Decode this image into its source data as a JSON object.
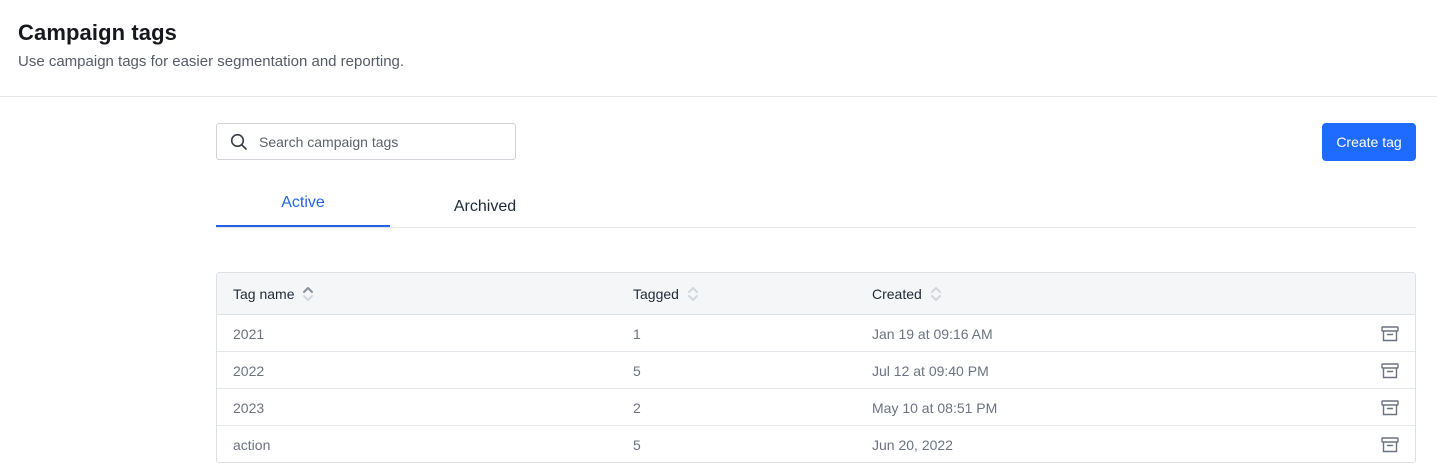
{
  "header": {
    "title": "Campaign tags",
    "subtitle": "Use campaign tags for easier segmentation and reporting."
  },
  "search": {
    "placeholder": "Search campaign tags",
    "value": "",
    "icon": "search-icon"
  },
  "toolbar": {
    "create_label": "Create tag"
  },
  "tabs": [
    {
      "label": "Active",
      "active": true
    },
    {
      "label": "Archived",
      "active": false
    }
  ],
  "table": {
    "columns": [
      {
        "label": "Tag name",
        "sortable": true
      },
      {
        "label": "Tagged",
        "sortable": true
      },
      {
        "label": "Created",
        "sortable": true
      }
    ],
    "rows": [
      {
        "name": "2021",
        "tagged": "1",
        "created": "Jan 19 at 09:16 AM",
        "action_icon": "archive-icon"
      },
      {
        "name": "2022",
        "tagged": "5",
        "created": "Jul 12 at 09:40 PM",
        "action_icon": "archive-icon"
      },
      {
        "name": "2023",
        "tagged": "2",
        "created": "May 10 at 08:51 PM",
        "action_icon": "archive-icon"
      },
      {
        "name": "action",
        "tagged": "5",
        "created": "Jun 20, 2022",
        "action_icon": "archive-icon"
      }
    ]
  },
  "colors": {
    "accent": "#1f6bff",
    "active_tab": "#2563eb",
    "header_bg": "#f5f6f8",
    "muted_text": "#6b7280"
  }
}
